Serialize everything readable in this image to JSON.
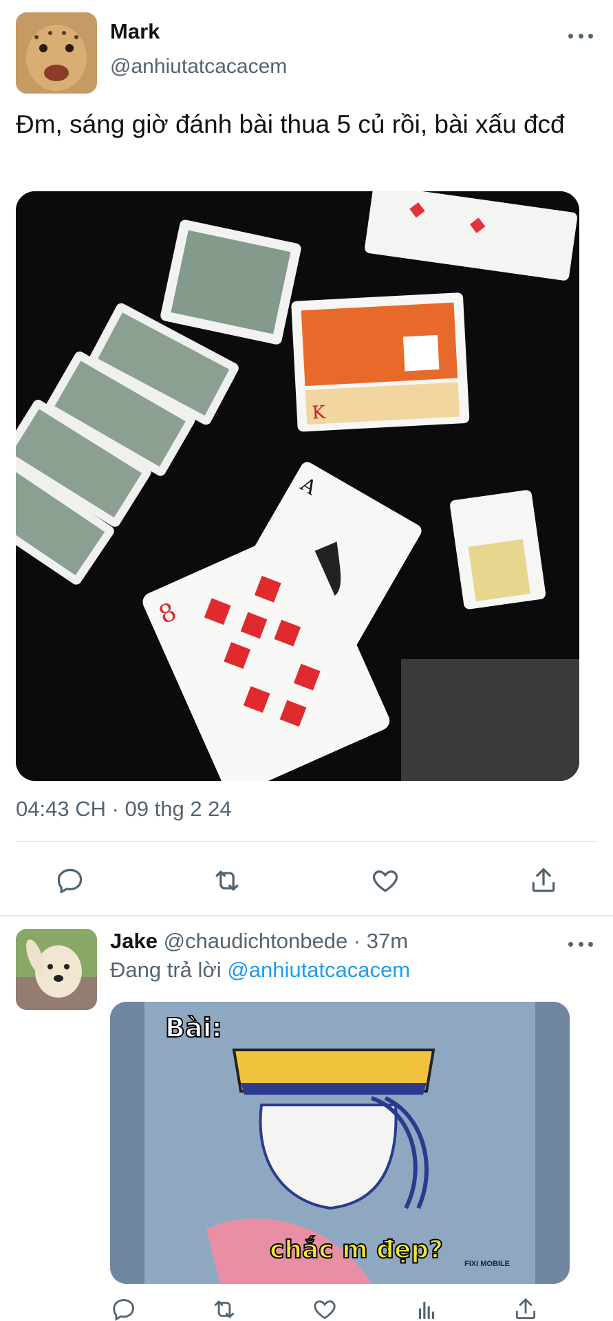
{
  "tweet": {
    "author_name": "Mark",
    "author_handle": "@anhiutatcacacem",
    "text": "Đm, sáng giờ đánh bài thua 5 củ rồi, bài xấu đcđ",
    "timestamp": "04:43 CH · 09 thg 2 24",
    "actions": [
      "reply-icon",
      "retweet-icon",
      "like-icon",
      "share-icon"
    ]
  },
  "reply": {
    "author_name": "Jake",
    "author_handle": "@chaudichtonbede",
    "time_ago": "· 37m",
    "replying_prefix": "Đang trả lời",
    "replying_to": "@anhiutatcacacem",
    "meme": {
      "top_text": "Bài:",
      "bottom_text": "chắc m đẹp?",
      "watermark": "FIXI MOBILE"
    },
    "actions": [
      "reply-icon",
      "retweet-icon",
      "like-icon",
      "views-icon",
      "share-icon"
    ]
  },
  "colors": {
    "text_primary": "#0f1419",
    "text_secondary": "#536471",
    "link": "#1d9bf0",
    "divider": "#e6e9ec"
  }
}
